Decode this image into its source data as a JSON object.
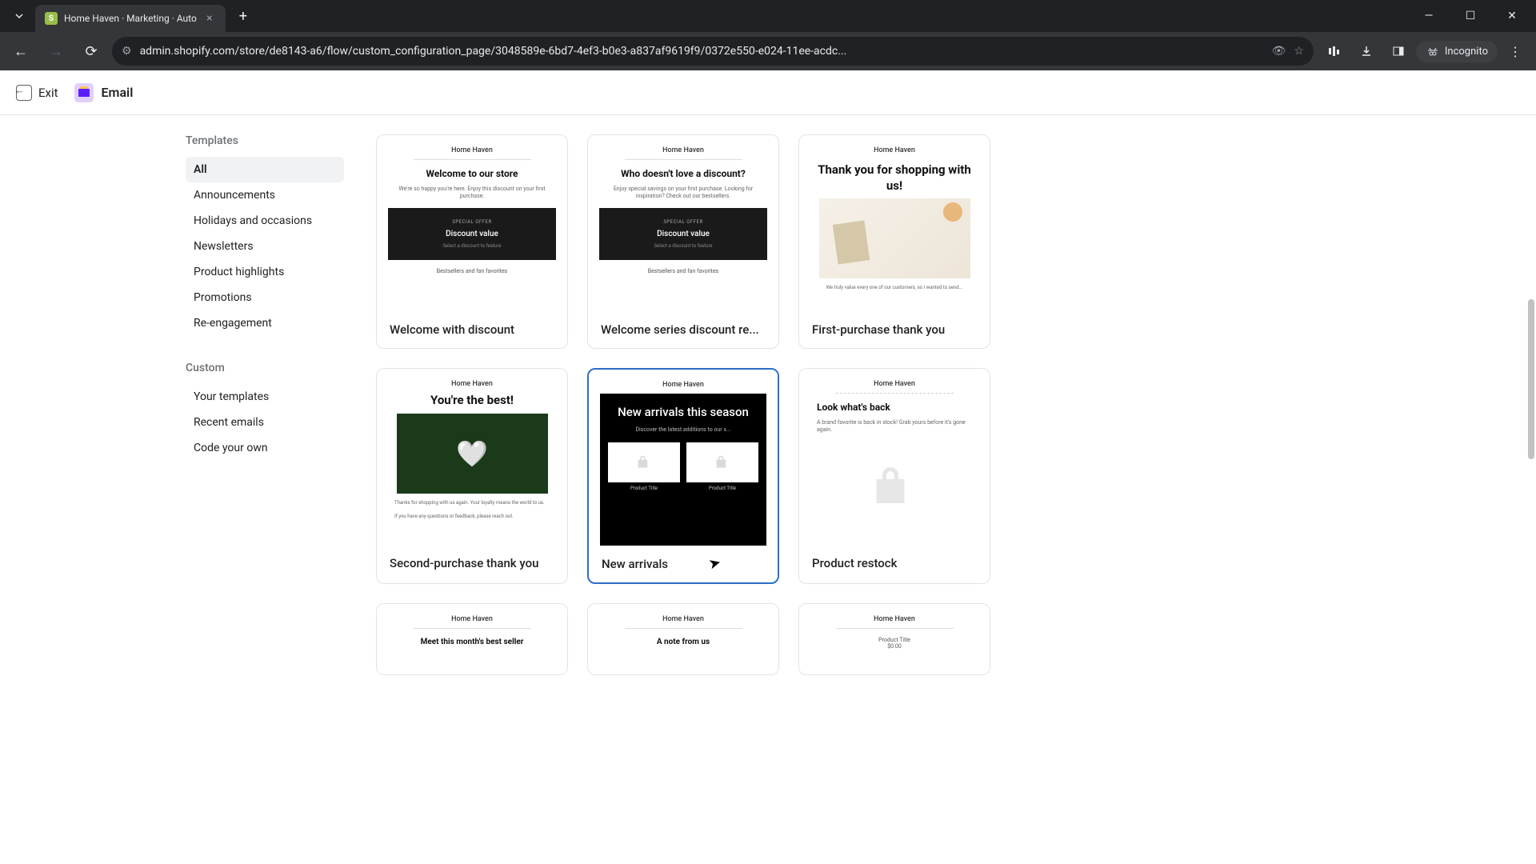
{
  "browser": {
    "tab_title": "Home Haven · Marketing · Auto",
    "url": "admin.shopify.com/store/de8143-a6/flow/custom_configuration_page/3048589e-6bd7-4ef3-b0e3-a837af9619f9/0372e550-e024-11ee-acdc...",
    "incognito_label": "Incognito"
  },
  "header": {
    "exit_label": "Exit",
    "app_name": "Email"
  },
  "sidebar": {
    "templates_heading": "Templates",
    "template_categories": [
      {
        "label": "All",
        "active": true
      },
      {
        "label": "Announcements",
        "active": false
      },
      {
        "label": "Holidays and occasions",
        "active": false
      },
      {
        "label": "Newsletters",
        "active": false
      },
      {
        "label": "Product highlights",
        "active": false
      },
      {
        "label": "Promotions",
        "active": false
      },
      {
        "label": "Re-engagement",
        "active": false
      }
    ],
    "custom_heading": "Custom",
    "custom_items": [
      {
        "label": "Your templates"
      },
      {
        "label": "Recent emails"
      },
      {
        "label": "Code your own"
      }
    ]
  },
  "templates": [
    {
      "id": "welcome-discount",
      "title": "Welcome with discount",
      "store": "Home Haven",
      "headline": "Welcome to our store",
      "sub": "We're so happy you're here. Enjoy this discount on your first purchase.",
      "special_label": "SPECIAL OFFER",
      "discount_label": "Discount value",
      "discount_sub": "Select a discount to feature",
      "footer": "Bestsellers and fan favorites"
    },
    {
      "id": "welcome-series",
      "title": "Welcome series discount re...",
      "store": "Home Haven",
      "headline": "Who doesn't love a discount?",
      "sub": "Enjoy special savings on your first purchase. Looking for inspiration? Check out our bestsellers.",
      "special_label": "SPECIAL OFFER",
      "discount_label": "Discount value",
      "discount_sub": "Select a discount to feature",
      "footer": "Bestsellers and fan favorites"
    },
    {
      "id": "first-purchase",
      "title": "First-purchase thank you",
      "store": "Home Haven",
      "headline": "Thank you for shopping with us!",
      "footer": "We truly value every one of our customers, so I wanted to send..."
    },
    {
      "id": "second-purchase",
      "title": "Second-purchase thank you",
      "store": "Home Haven",
      "headline": "You're the best!",
      "sub1": "Thanks for shopping with us again. Your loyalty means the world to us.",
      "sub2": "If you have any questions or feedback, please reach out."
    },
    {
      "id": "new-arrivals",
      "title": "New arrivals",
      "store": "Home Haven",
      "headline": "New arrivals this season",
      "sub": "Discover the latest additions to our s...",
      "product_label": "Product Title",
      "selected": true
    },
    {
      "id": "product-restock",
      "title": "Product restock",
      "store": "Home Haven",
      "headline": "Look what's back",
      "sub": "A brand favorite is back in stock! Grab yours before it's gone again."
    },
    {
      "id": "best-seller",
      "title": "",
      "store": "Home Haven",
      "headline": "Meet this month's best seller"
    },
    {
      "id": "note-from-us",
      "title": "",
      "store": "Home Haven",
      "headline": "A note from us"
    },
    {
      "id": "product-feature",
      "title": "",
      "store": "Home Haven",
      "product_label": "Product Title",
      "price": "$0.00"
    }
  ]
}
